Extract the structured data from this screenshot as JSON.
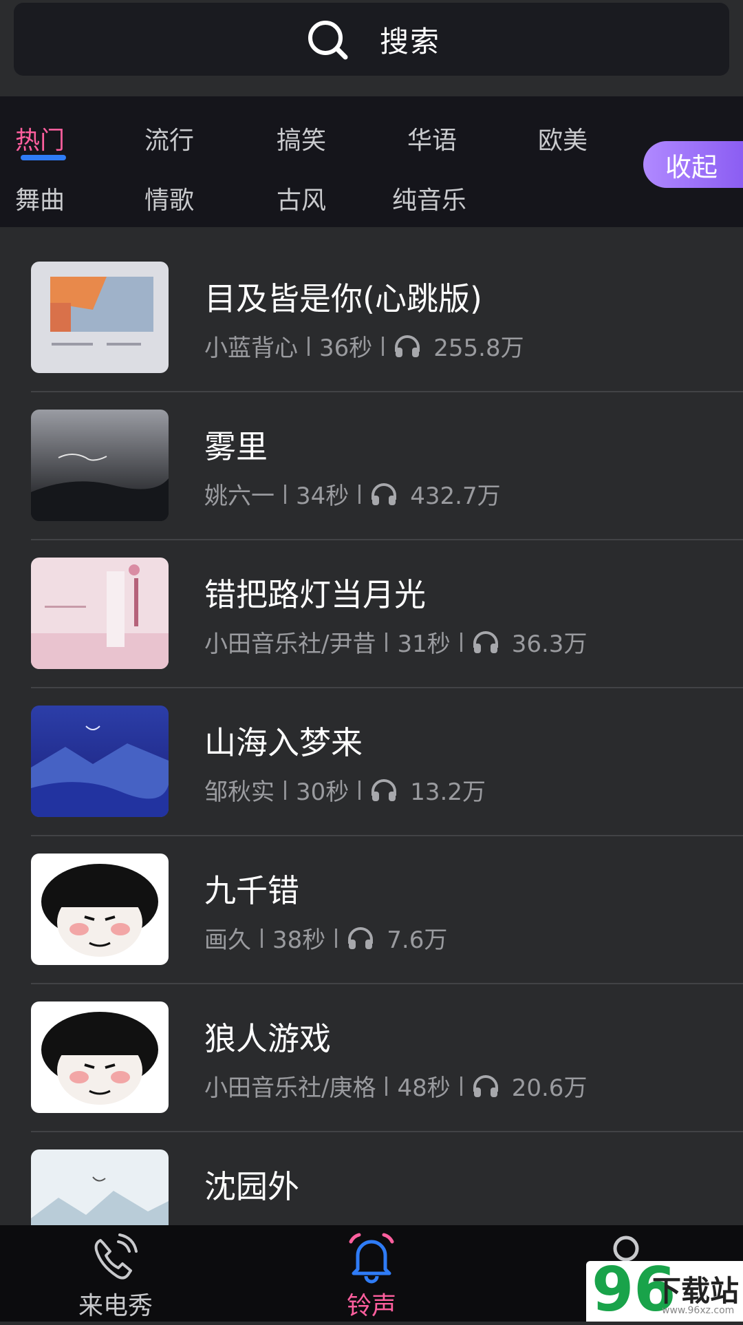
{
  "search": {
    "label": "搜索"
  },
  "categories": {
    "row1": [
      "热门",
      "流行",
      "搞笑",
      "华语",
      "欧美"
    ],
    "row2": [
      "舞曲",
      "情歌",
      "古风",
      "纯音乐"
    ],
    "active": "热门",
    "collapse_label": "收起"
  },
  "songs": [
    {
      "title": "目及皆是你(心跳版)",
      "artist": "小蓝背心",
      "duration": "36秒",
      "plays": "255.8万"
    },
    {
      "title": "雾里",
      "artist": "姚六一",
      "duration": "34秒",
      "plays": "432.7万"
    },
    {
      "title": "错把路灯当月光",
      "artist": "小田音乐社/尹昔",
      "duration": "31秒",
      "plays": "36.3万"
    },
    {
      "title": "山海入梦来",
      "artist": "邹秋实",
      "duration": "30秒",
      "plays": "13.2万"
    },
    {
      "title": "九千错",
      "artist": "画久",
      "duration": "38秒",
      "plays": "7.6万"
    },
    {
      "title": "狼人游戏",
      "artist": "小田音乐社/庚格",
      "duration": "48秒",
      "plays": "20.6万"
    },
    {
      "title": "沈园外",
      "artist": "",
      "duration": "",
      "plays": ""
    }
  ],
  "tabbar": {
    "tabs": [
      {
        "label": "来电秀",
        "icon": "phone-icon"
      },
      {
        "label": "铃声",
        "icon": "bell-icon",
        "active": true
      },
      {
        "label": "",
        "icon": "profile-icon"
      }
    ]
  },
  "watermark": {
    "number": "96",
    "text": "下载站",
    "url": "www.96xz.com"
  },
  "colors": {
    "accent_pink": "#ff5f9e",
    "accent_blue": "#2f7cf6",
    "collapse_purple": "#9b6ff7"
  }
}
